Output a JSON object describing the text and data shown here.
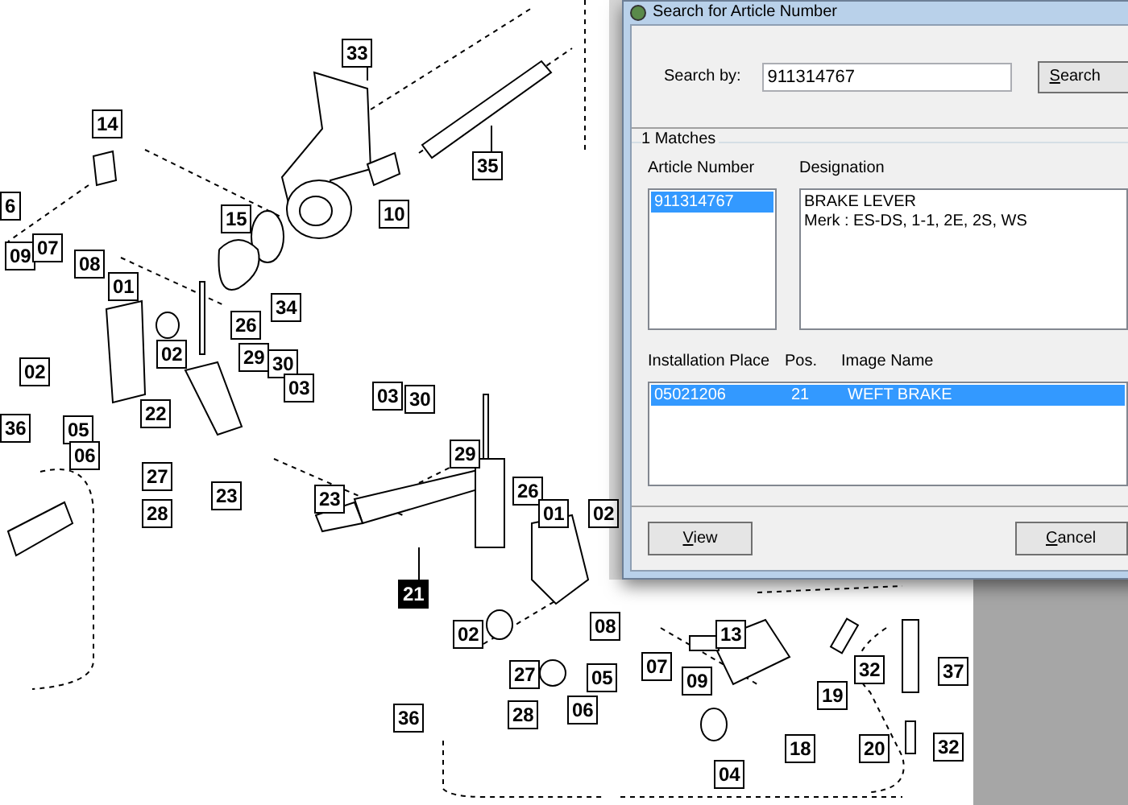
{
  "drawing": {
    "callouts": [
      {
        "label": "33",
        "highlighted": false
      },
      {
        "label": "14",
        "highlighted": false
      },
      {
        "label": "35",
        "highlighted": false
      },
      {
        "label": "15",
        "highlighted": false
      },
      {
        "label": "10",
        "highlighted": false
      },
      {
        "label": "6",
        "highlighted": false
      },
      {
        "label": "09",
        "highlighted": false
      },
      {
        "label": "07",
        "highlighted": false
      },
      {
        "label": "08",
        "highlighted": false
      },
      {
        "label": "01",
        "highlighted": false
      },
      {
        "label": "34",
        "highlighted": false
      },
      {
        "label": "26",
        "highlighted": false
      },
      {
        "label": "02",
        "highlighted": false
      },
      {
        "label": "02",
        "highlighted": false
      },
      {
        "label": "29",
        "highlighted": false
      },
      {
        "label": "30",
        "highlighted": false
      },
      {
        "label": "03",
        "highlighted": false
      },
      {
        "label": "03",
        "highlighted": false
      },
      {
        "label": "30",
        "highlighted": false
      },
      {
        "label": "36",
        "highlighted": false
      },
      {
        "label": "22",
        "highlighted": false
      },
      {
        "label": "05",
        "highlighted": false
      },
      {
        "label": "06",
        "highlighted": false
      },
      {
        "label": "27",
        "highlighted": false
      },
      {
        "label": "23",
        "highlighted": false
      },
      {
        "label": "28",
        "highlighted": false
      },
      {
        "label": "29",
        "highlighted": false
      },
      {
        "label": "26",
        "highlighted": false
      },
      {
        "label": "23",
        "highlighted": false
      },
      {
        "label": "01",
        "highlighted": false
      },
      {
        "label": "02",
        "highlighted": false
      },
      {
        "label": "21",
        "highlighted": true
      },
      {
        "label": "02",
        "highlighted": false
      },
      {
        "label": "08",
        "highlighted": false
      },
      {
        "label": "27",
        "highlighted": false
      },
      {
        "label": "05",
        "highlighted": false
      },
      {
        "label": "36",
        "highlighted": false
      },
      {
        "label": "28",
        "highlighted": false
      },
      {
        "label": "06",
        "highlighted": false
      },
      {
        "label": "07",
        "highlighted": false
      },
      {
        "label": "09",
        "highlighted": false
      },
      {
        "label": "13",
        "highlighted": false
      },
      {
        "label": "04",
        "highlighted": false
      },
      {
        "label": "18",
        "highlighted": false
      },
      {
        "label": "20",
        "highlighted": false
      },
      {
        "label": "19",
        "highlighted": false
      },
      {
        "label": "32",
        "highlighted": false
      },
      {
        "label": "37",
        "highlighted": false
      },
      {
        "label": "32",
        "highlighted": false
      }
    ]
  },
  "dialog": {
    "title": "Search for Article Number",
    "search": {
      "label": "Search by:",
      "value": "911314767",
      "button": "Search"
    },
    "matches": {
      "title": "1 Matches",
      "article_header": "Article Number",
      "designation_header": "Designation",
      "articles": [
        {
          "text": "911314767",
          "selected": true
        }
      ],
      "designation_lines": [
        "BRAKE LEVER",
        "Merk : ES-DS, 1-1, 2E, 2S, WS"
      ],
      "columns": [
        "Installation Place",
        "Pos.",
        "Image Name"
      ],
      "rows": [
        {
          "cells": [
            "05021206",
            "21",
            "WEFT BRAKE"
          ],
          "selected": true
        }
      ]
    },
    "buttons": [
      {
        "label": "View"
      },
      {
        "label": "Cancel"
      }
    ]
  }
}
